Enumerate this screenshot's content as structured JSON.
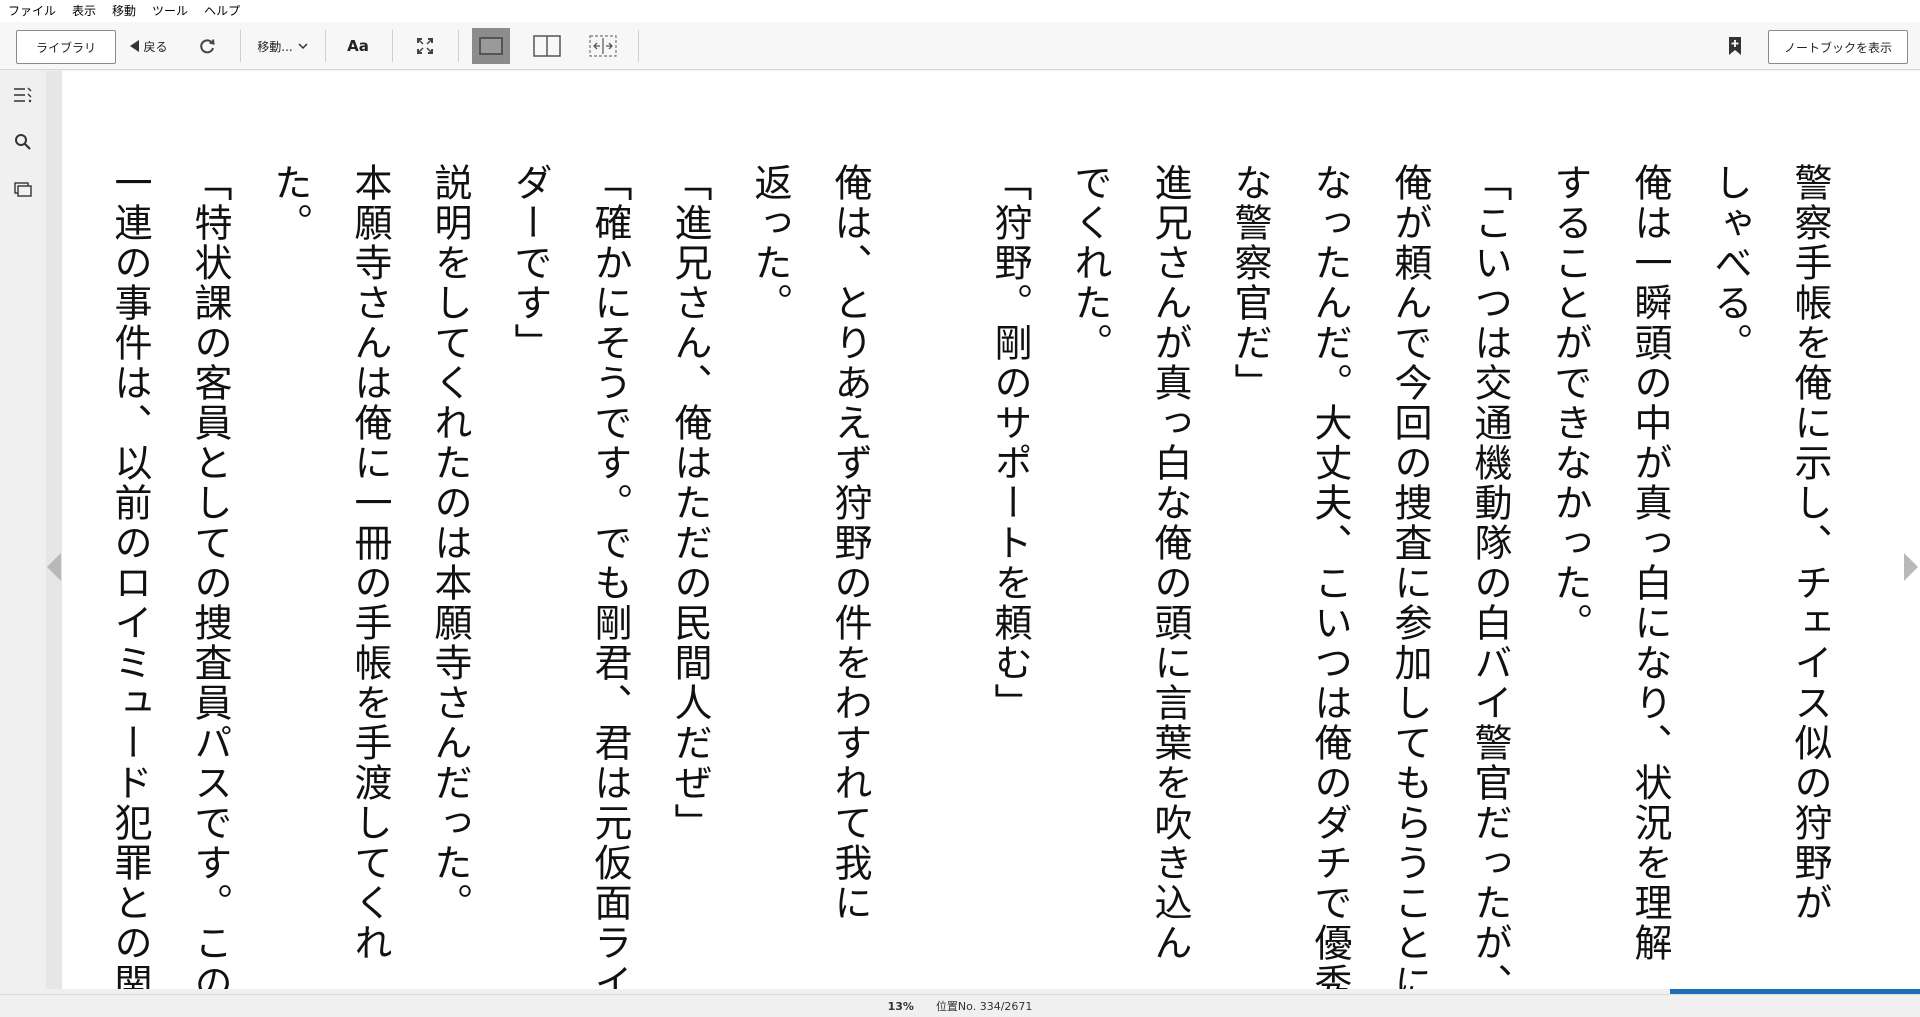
{
  "menu": [
    "ファイル",
    "表示",
    "移動",
    "ツール",
    "ヘルプ"
  ],
  "toolbar": {
    "library_label": "ライブラリ",
    "back_label": "戻る",
    "goto_label": "移動...",
    "font_label": "Aa",
    "notebook_label": "ノートブックを表示"
  },
  "book": {
    "columns": [
      "警察手帳を俺に示し、チェイス似の狩野が",
      "しゃべる。",
      "俺は一瞬頭の中が真っ白になり、状況を理解",
      "することができなかった。",
      "「こいつは交通機動隊の白バイ警官だったが、",
      "俺が頼んで今回の捜査に参加してもらうことに",
      "なったんだ。大丈夫、こいつは俺のダチで優秀",
      "な警察官だ」",
      "進兄さんが真っ白な俺の頭に言葉を吹き込ん",
      "でくれた。",
      "「狩野。剛のサポートを頼む」",
      "",
      "俺は、とりあえず狩野の件をわすれて我に",
      "返った。",
      "「進兄さん、俺はただの民間人だぜ」",
      "「確かにそうです。でも剛君、君は元仮面ライ",
      "ダーです」",
      "説明をしてくれたのは本願寺さんだった。",
      "本願寺さんは俺に一冊の手帳を手渡してくれ",
      "た。",
      "「特状課の客員としての捜査員パスです。この",
      "一連の事件は、以前のロイミュード犯罪との関"
    ]
  },
  "status": {
    "percent": "13%",
    "location": "位置No. 334/2671",
    "progress": 0.13
  }
}
